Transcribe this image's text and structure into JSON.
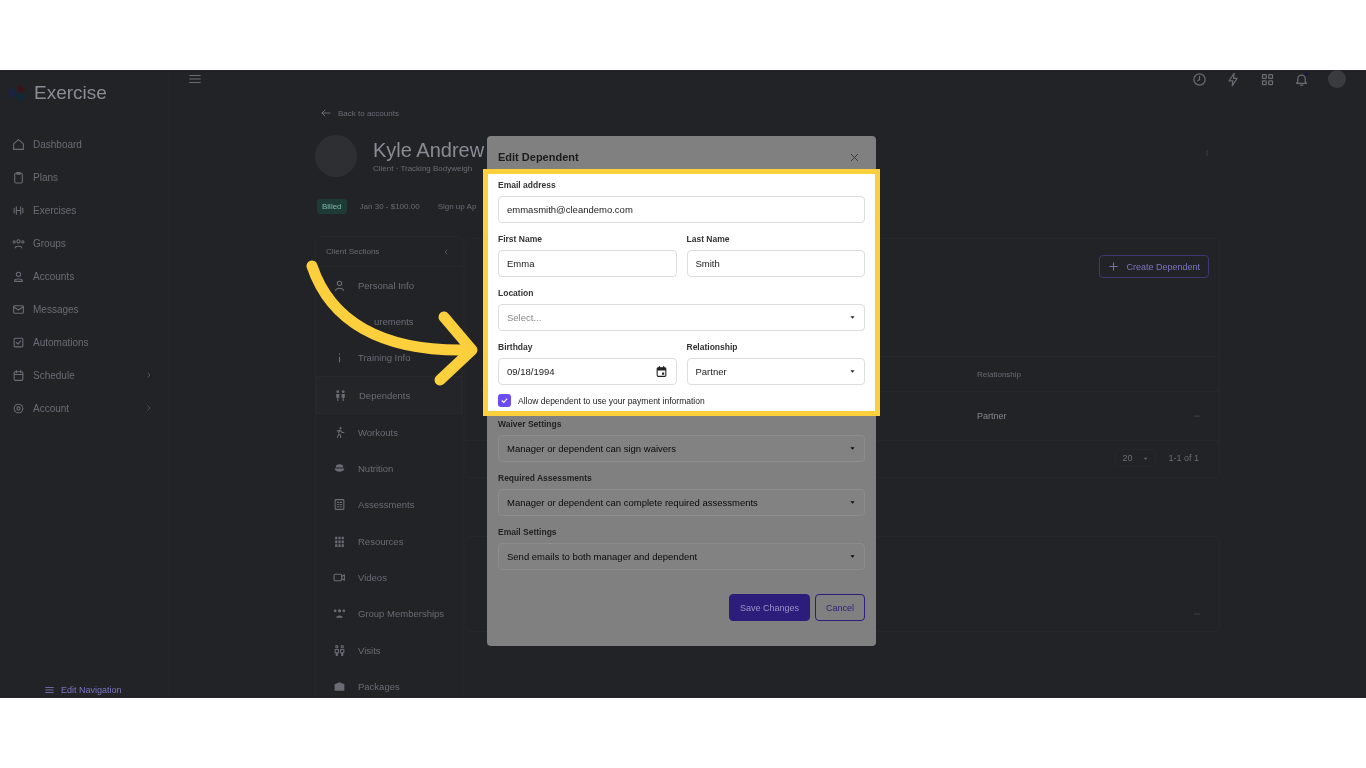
{
  "app": {
    "logo": "Exercise"
  },
  "sidebar": {
    "items": [
      {
        "label": "Dashboard",
        "expandable": false
      },
      {
        "label": "Plans",
        "expandable": false
      },
      {
        "label": "Exercises",
        "expandable": false
      },
      {
        "label": "Groups",
        "expandable": false
      },
      {
        "label": "Accounts",
        "expandable": false
      },
      {
        "label": "Messages",
        "expandable": false
      },
      {
        "label": "Automations",
        "expandable": false
      },
      {
        "label": "Schedule",
        "expandable": true
      },
      {
        "label": "Account",
        "expandable": true
      }
    ],
    "footer_link": "Edit Navigation"
  },
  "page": {
    "back_link": "Back to accounts",
    "name": "Kyle Andrew",
    "subtitle": "Client · Tracking Bodyweigh",
    "badges": [
      {
        "text": "Billed",
        "kind": "status"
      },
      {
        "text": "Jan 30 - $100.00",
        "kind": "plain"
      },
      {
        "text": "Sign up Ap",
        "kind": "plain"
      }
    ],
    "client_sections": {
      "title": "Client Sections",
      "items": [
        {
          "label": "Personal Info",
          "selected": false
        },
        {
          "label": "urements",
          "selected": false
        },
        {
          "label": "Training Info",
          "selected": false
        },
        {
          "label": "Dependents",
          "selected": true
        },
        {
          "label": "Workouts",
          "selected": false
        },
        {
          "label": "Nutrition",
          "selected": false
        },
        {
          "label": "Assessments",
          "selected": false
        },
        {
          "label": "Resources",
          "selected": false
        },
        {
          "label": "Videos",
          "selected": false
        },
        {
          "label": "Group Memberships",
          "selected": false
        },
        {
          "label": "Visits",
          "selected": false
        },
        {
          "label": "Packages",
          "selected": false
        }
      ]
    },
    "dependents": {
      "create_button": "Create Dependent",
      "columns": [
        "Relationship"
      ],
      "rows": [
        {
          "relationship": "Partner"
        }
      ],
      "page_size": "20",
      "range": "1-1 of 1"
    }
  },
  "modal": {
    "title": "Edit Dependent",
    "highlighted": {
      "rows": [
        [
          {
            "kind": "text",
            "label": "Email address",
            "value": "emmasmith@cleandemo.com"
          }
        ],
        [
          {
            "kind": "text",
            "label": "First Name",
            "value": "Emma"
          },
          {
            "kind": "text",
            "label": "Last Name",
            "value": "Smith"
          }
        ],
        [
          {
            "kind": "select",
            "label": "Location",
            "placeholder": "Select..."
          }
        ],
        [
          {
            "kind": "date",
            "label": "Birthday",
            "value": "09/18/1994"
          },
          {
            "kind": "select",
            "label": "Relationship",
            "value": "Partner"
          }
        ]
      ],
      "checkbox": {
        "label": "Allow dependent to use your payment information",
        "checked": true
      }
    },
    "rows": [
      [
        {
          "kind": "select",
          "label": "Waiver Settings",
          "value": "Manager or dependent can sign waivers"
        }
      ],
      [
        {
          "kind": "select",
          "label": "Required Assessments",
          "value": "Manager or dependent can complete required assessments"
        }
      ],
      [
        {
          "kind": "select",
          "label": "Email Settings",
          "value": "Send emails to both manager and dependent"
        }
      ]
    ],
    "buttons": [
      {
        "label": "Save Changes",
        "kind": "primary"
      },
      {
        "label": "Cancel",
        "kind": "secondary"
      }
    ]
  }
}
